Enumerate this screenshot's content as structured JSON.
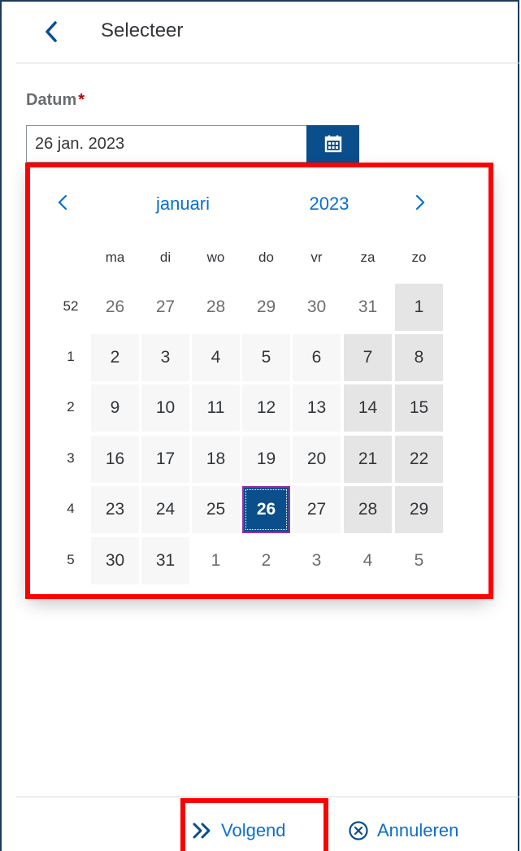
{
  "header": {
    "title": "Selecteer",
    "back_icon": "chevron-left-icon"
  },
  "form": {
    "label": "Datum",
    "required_mark": "*",
    "date_value": "26 jan. 2023",
    "calendar_icon": "calendar-icon"
  },
  "calendar": {
    "month": "januari",
    "year": "2023",
    "weekdays": [
      "ma",
      "di",
      "wo",
      "do",
      "vr",
      "za",
      "zo"
    ],
    "weeks": [
      {
        "week": "52",
        "days": [
          {
            "d": "26",
            "type": "other"
          },
          {
            "d": "27",
            "type": "other"
          },
          {
            "d": "28",
            "type": "other"
          },
          {
            "d": "29",
            "type": "other"
          },
          {
            "d": "30",
            "type": "other"
          },
          {
            "d": "31",
            "type": "other"
          },
          {
            "d": "1",
            "type": "weekend"
          }
        ]
      },
      {
        "week": "1",
        "days": [
          {
            "d": "2",
            "type": "cur"
          },
          {
            "d": "3",
            "type": "cur"
          },
          {
            "d": "4",
            "type": "cur"
          },
          {
            "d": "5",
            "type": "cur"
          },
          {
            "d": "6",
            "type": "cur"
          },
          {
            "d": "7",
            "type": "weekend"
          },
          {
            "d": "8",
            "type": "weekend"
          }
        ]
      },
      {
        "week": "2",
        "days": [
          {
            "d": "9",
            "type": "cur"
          },
          {
            "d": "10",
            "type": "cur"
          },
          {
            "d": "11",
            "type": "cur"
          },
          {
            "d": "12",
            "type": "cur"
          },
          {
            "d": "13",
            "type": "cur"
          },
          {
            "d": "14",
            "type": "weekend"
          },
          {
            "d": "15",
            "type": "weekend"
          }
        ]
      },
      {
        "week": "3",
        "days": [
          {
            "d": "16",
            "type": "cur"
          },
          {
            "d": "17",
            "type": "cur"
          },
          {
            "d": "18",
            "type": "cur"
          },
          {
            "d": "19",
            "type": "cur"
          },
          {
            "d": "20",
            "type": "cur"
          },
          {
            "d": "21",
            "type": "weekend"
          },
          {
            "d": "22",
            "type": "weekend"
          }
        ]
      },
      {
        "week": "4",
        "days": [
          {
            "d": "23",
            "type": "cur"
          },
          {
            "d": "24",
            "type": "cur"
          },
          {
            "d": "25",
            "type": "cur"
          },
          {
            "d": "26",
            "type": "selected"
          },
          {
            "d": "27",
            "type": "cur"
          },
          {
            "d": "28",
            "type": "weekend"
          },
          {
            "d": "29",
            "type": "weekend"
          }
        ]
      },
      {
        "week": "5",
        "days": [
          {
            "d": "30",
            "type": "cur"
          },
          {
            "d": "31",
            "type": "cur"
          },
          {
            "d": "1",
            "type": "other"
          },
          {
            "d": "2",
            "type": "other"
          },
          {
            "d": "3",
            "type": "other"
          },
          {
            "d": "4",
            "type": "other"
          },
          {
            "d": "5",
            "type": "other"
          }
        ]
      }
    ]
  },
  "footer": {
    "next_label": "Volgend",
    "next_icon": "double-chevron-right-icon",
    "cancel_label": "Annuleren",
    "cancel_icon": "circle-x-icon"
  },
  "colors": {
    "accent": "#0a6ed1",
    "selected_bg": "#0a4e8c",
    "highlight": "#ff0000",
    "weekend_bg": "#e5e5e5"
  }
}
